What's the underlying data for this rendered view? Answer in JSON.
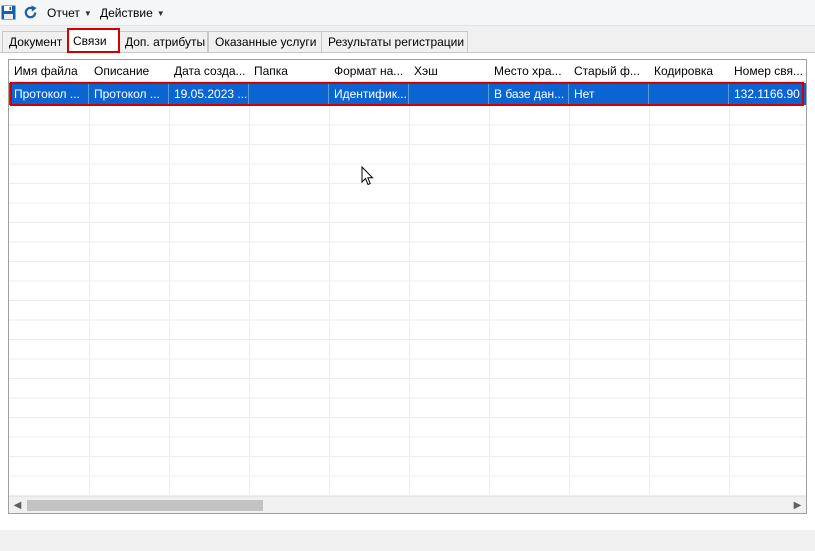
{
  "toolbar": {
    "save_icon": "save-icon",
    "refresh_icon": "refresh-icon",
    "menus": [
      {
        "label": "Отчет"
      },
      {
        "label": "Действие"
      }
    ]
  },
  "tabs": [
    {
      "label": "Документ"
    },
    {
      "label": "Связи",
      "active": true
    },
    {
      "label": "Доп. атрибуты"
    },
    {
      "label": "Оказанные услуги"
    },
    {
      "label": "Результаты регистрации"
    }
  ],
  "grid": {
    "columns": [
      "Имя файла",
      "Описание",
      "Дата созда...",
      "Папка",
      "Формат на...",
      "Хэш",
      "Место хра...",
      "Старый ф...",
      "Кодировка",
      "Номер свя..."
    ],
    "rows": [
      [
        "Протокол ...",
        "Протокол ...",
        "19.05.2023 ...",
        "",
        "Идентифик...",
        "",
        "В базе дан...",
        "Нет",
        "",
        "132.1166.90"
      ]
    ]
  },
  "colors": {
    "selection": "#0a64d2",
    "highlight_border": "#d40000",
    "accent_icon": "#1a5fa8"
  }
}
